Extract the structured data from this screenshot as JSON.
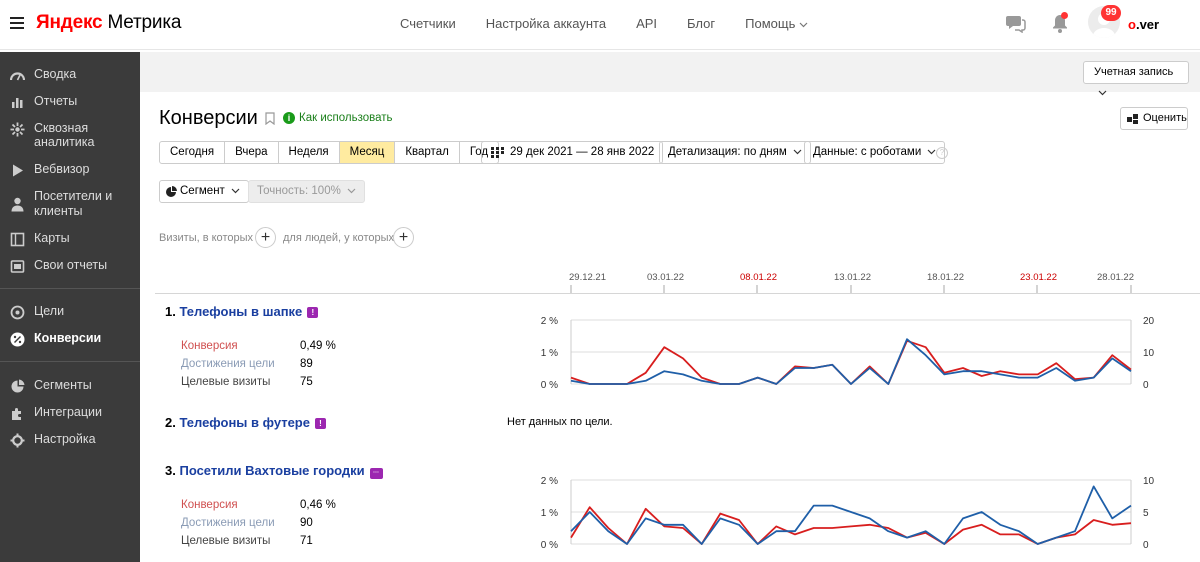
{
  "header": {
    "logo_brand": "Яндекс",
    "logo_product": " Метрика",
    "nav": [
      "Счетчики",
      "Настройка аккаунта",
      "API",
      "Блог",
      "Помощь"
    ],
    "badge_count": "99",
    "username_first": "o",
    "username_rest": ".ver"
  },
  "sidebar": {
    "items": [
      {
        "label": "Сводка",
        "icon": "dashboard-icon"
      },
      {
        "label": "Отчеты",
        "icon": "reports-icon"
      },
      {
        "label": "Сквозная аналитика",
        "icon": "analytics-icon"
      },
      {
        "label": "Вебвизор",
        "icon": "play-icon"
      },
      {
        "label": "Посетители и клиенты",
        "icon": "person-icon"
      },
      {
        "label": "Карты",
        "icon": "map-icon"
      },
      {
        "label": "Свои отчеты",
        "icon": "custom-report-icon"
      },
      {
        "label": "Цели",
        "icon": "target-icon"
      },
      {
        "label": "Конверсии",
        "icon": "percent-icon"
      },
      {
        "label": "Сегменты",
        "icon": "segments-icon"
      },
      {
        "label": "Интеграции",
        "icon": "puzzle-icon"
      },
      {
        "label": "Настройка",
        "icon": "gear-icon"
      }
    ],
    "active": "Конверсии"
  },
  "account_button": "Учетная запись",
  "page": {
    "title": "Конверсии",
    "howto": "Как использовать",
    "rate_button": "Оценить"
  },
  "periods": [
    "Сегодня",
    "Вчера",
    "Неделя",
    "Месяц",
    "Квартал",
    "Год"
  ],
  "selected_period": "Месяц",
  "date_range": "29 дек 2021 — 28 янв 2022",
  "detail": "Детализация: по дням",
  "data_mode": "Данные: с роботами",
  "segment": "Сегмент",
  "accuracy": "Точность: 100%",
  "filters": {
    "visits_label": "Визиты, в которых",
    "people_label": "для людей, у которых"
  },
  "timeline": {
    "dates": [
      "29.12.21",
      "03.01.22",
      "08.01.22",
      "13.01.22",
      "18.01.22",
      "23.01.22",
      "28.01.22"
    ],
    "weekend_dates": [
      "08.01.22",
      "23.01.22"
    ]
  },
  "colors": {
    "conversion": "#d81e1e",
    "visits": "#1f5fa8",
    "link": "#1a3fa0",
    "goal_badge": "#9c27b0"
  },
  "goals": [
    {
      "num": "1.",
      "name": "Телефоны в шапке",
      "metrics": [
        {
          "label": "Конверсия",
          "value": "0,49 %"
        },
        {
          "label": "Достижения цели",
          "value": "89"
        },
        {
          "label": "Целевые визиты",
          "value": "75"
        }
      ]
    },
    {
      "num": "2.",
      "name": "Телефоны в футере",
      "nodata": "Нет данных по цели."
    },
    {
      "num": "3.",
      "name": "Посетили Вахтовые городки",
      "metrics": [
        {
          "label": "Конверсия",
          "value": "0,46 %"
        },
        {
          "label": "Достижения цели",
          "value": "90"
        },
        {
          "label": "Целевые визиты",
          "value": "71"
        }
      ]
    }
  ],
  "chart_data": [
    {
      "type": "line",
      "title": "Телефоны в шапке",
      "x": [
        "29.12",
        "30.12",
        "31.12",
        "01.01",
        "02.01",
        "03.01",
        "04.01",
        "05.01",
        "06.01",
        "07.01",
        "08.01",
        "09.01",
        "10.01",
        "11.01",
        "12.01",
        "13.01",
        "14.01",
        "15.01",
        "16.01",
        "17.01",
        "18.01",
        "19.01",
        "20.01",
        "21.01",
        "22.01",
        "23.01",
        "24.01",
        "25.01",
        "26.01",
        "27.01",
        "28.01"
      ],
      "y_left_ticks": [
        "0 %",
        "1 %",
        "2 %"
      ],
      "y_right_ticks": [
        "0",
        "10",
        "20"
      ],
      "ylim_left": [
        0,
        2
      ],
      "ylim_right": [
        0,
        20
      ],
      "series": [
        {
          "axis": "left",
          "values": [
            0.2,
            0,
            0,
            0,
            0.35,
            1.15,
            0.8,
            0.2,
            0,
            0,
            0.2,
            0,
            0.55,
            0.5,
            0.6,
            0,
            0.55,
            0,
            1.35,
            1.15,
            0.35,
            0.5,
            0.25,
            0.4,
            0.3,
            0.3,
            0.65,
            0.15,
            0.2,
            0.9,
            0.45
          ]
        },
        {
          "axis": "right",
          "values": [
            1,
            0,
            0,
            0,
            1,
            4,
            3,
            1,
            0,
            0,
            2,
            0,
            5,
            5,
            6,
            0,
            5,
            0,
            14,
            9,
            3,
            4,
            4,
            3,
            2,
            2,
            5,
            1,
            2,
            8,
            4
          ]
        }
      ]
    },
    {
      "type": "line",
      "title": "Посетили Вахтовые городки",
      "x": [
        "29.12",
        "30.12",
        "31.12",
        "01.01",
        "02.01",
        "03.01",
        "04.01",
        "05.01",
        "06.01",
        "07.01",
        "08.01",
        "09.01",
        "10.01",
        "11.01",
        "12.01",
        "13.01",
        "14.01",
        "15.01",
        "16.01",
        "17.01",
        "18.01",
        "19.01",
        "20.01",
        "21.01",
        "22.01",
        "23.01",
        "24.01",
        "25.01",
        "26.01",
        "27.01",
        "28.01"
      ],
      "y_left_ticks": [
        "0 %",
        "1 %",
        "2 %"
      ],
      "y_right_ticks": [
        "0",
        "5",
        "10"
      ],
      "ylim_left": [
        0,
        2
      ],
      "ylim_right": [
        0,
        10
      ],
      "series": [
        {
          "axis": "left",
          "values": [
            0.2,
            1.15,
            0.5,
            0,
            1.1,
            0.55,
            0.5,
            0,
            0.95,
            0.75,
            0,
            0.55,
            0.3,
            0.5,
            0.5,
            0.55,
            0.6,
            0.5,
            0.2,
            0.35,
            0,
            0.45,
            0.6,
            0.3,
            0.3,
            0,
            0.2,
            0.3,
            0.75,
            0.6,
            0.65
          ]
        },
        {
          "axis": "right",
          "values": [
            2,
            5,
            2,
            0,
            4,
            3,
            3,
            0,
            4,
            3,
            0,
            2,
            2,
            6,
            6,
            5,
            4,
            2,
            1,
            2,
            0,
            4,
            5,
            3,
            2,
            0,
            1,
            2,
            9,
            4,
            6
          ]
        }
      ]
    }
  ]
}
